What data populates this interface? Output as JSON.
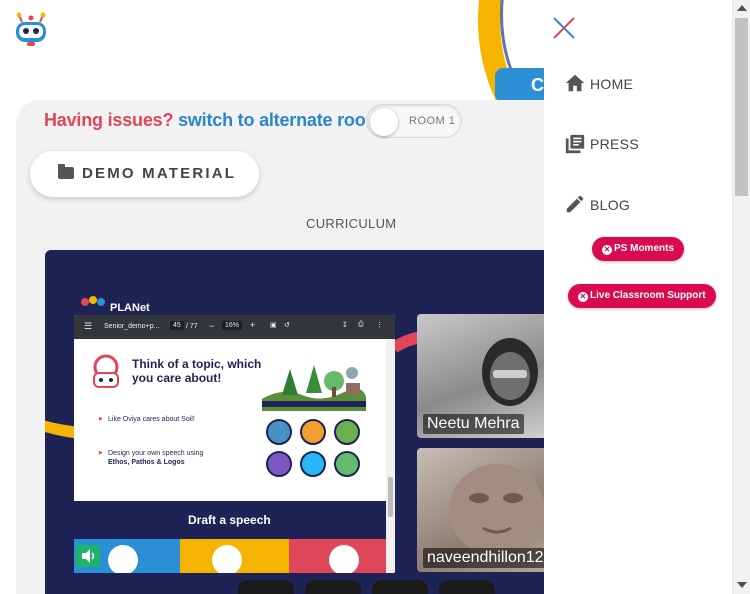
{
  "header": {
    "classroom_tab_label": "C"
  },
  "room_switch": {
    "issue_text": "Having issues?",
    "switch_text": "switch to alternate room",
    "toggle_label": "ROOM 1"
  },
  "demo_material": {
    "label": "DEMO MATERIAL"
  },
  "curriculum": {
    "label": "CURRICULUM"
  },
  "board": {
    "brand_text": "PLANet"
  },
  "pdf_viewer": {
    "filename": "Senior_demo+p...",
    "page_current": "45",
    "page_total": "/ 77",
    "zoom": "16%",
    "slide_title": "Think of a topic, which you care about!",
    "bullet_1": "Like Oviya cares about Soil!",
    "bullet_2_line1": "Design your own speech using",
    "bullet_2_line2": "Ethos, Pathos & Logos",
    "banner": "Draft a speech"
  },
  "videos": [
    {
      "name": "Neetu Mehra"
    },
    {
      "name": "naveendhillon12"
    }
  ],
  "side_menu": {
    "items": [
      {
        "label": "HOME",
        "icon": "home-icon"
      },
      {
        "label": "PRESS",
        "icon": "library-books-icon"
      },
      {
        "label": "BLOG",
        "icon": "pencil-icon"
      }
    ],
    "pills": [
      {
        "label": "PS Moments"
      },
      {
        "label": "Live Classroom Support"
      }
    ]
  },
  "colors": {
    "accent_red": "#e0465a",
    "accent_blue": "#2a86c9",
    "pill_pink": "#d90a4f",
    "board_navy": "#1f2255",
    "ring_yellow": "#f5b400"
  }
}
